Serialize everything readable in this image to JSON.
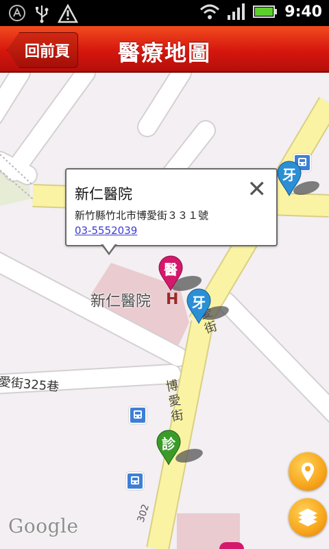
{
  "status_bar": {
    "time": "9:40"
  },
  "header": {
    "back_label": "回前頁",
    "title": "醫療地圖"
  },
  "callout": {
    "name": "新仁醫院",
    "address": "新竹縣竹北市博愛街３３１號",
    "phone": "03-5552039"
  },
  "map": {
    "place_label": "新仁醫院",
    "street_lane": "愛街325巷",
    "street_main_1": "博愛街",
    "street_main_2": "博愛街",
    "route_number": "302",
    "attribution": "Google"
  },
  "pins": [
    {
      "kind": "hospital",
      "label": "醫",
      "color": "#d4186c"
    },
    {
      "kind": "dentist",
      "label": "牙",
      "color": "#2b8fd6"
    },
    {
      "kind": "dentist",
      "label": "牙",
      "color": "#2b8fd6"
    },
    {
      "kind": "clinic",
      "label": "診",
      "color": "#3b9b2a"
    }
  ],
  "icons": {
    "status_left": [
      "alert-app-icon",
      "usb-icon",
      "warning-icon"
    ],
    "status_right": [
      "wifi-icon",
      "signal-icon",
      "battery-icon"
    ],
    "bus_stop": "bus-stop-icon",
    "locate": "location-pin-icon",
    "layers": "layers-icon"
  },
  "colors": {
    "header_red": "#d6160e",
    "road_yellow": "#fbf3a4",
    "fab_orange": "#f7a51a"
  }
}
